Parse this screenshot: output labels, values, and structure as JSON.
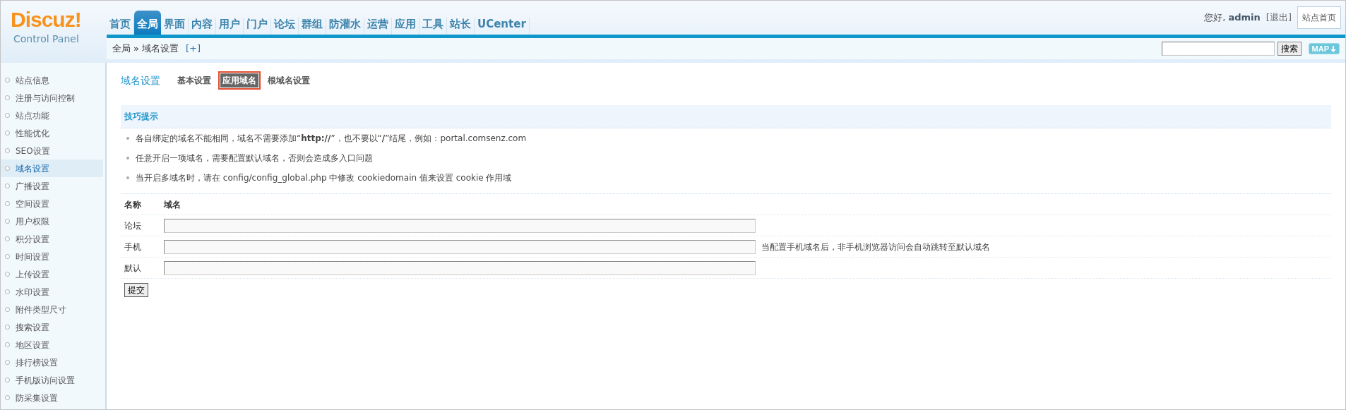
{
  "logo": {
    "title": "Discuz!",
    "subtitle": "Control Panel"
  },
  "nav": [
    {
      "label": "首页",
      "selected": false
    },
    {
      "label": "全局",
      "selected": true
    },
    {
      "label": "界面",
      "selected": false
    },
    {
      "label": "内容",
      "selected": false
    },
    {
      "label": "用户",
      "selected": false
    },
    {
      "label": "门户",
      "selected": false
    },
    {
      "label": "论坛",
      "selected": false
    },
    {
      "label": "群组",
      "selected": false
    },
    {
      "label": "防灌水",
      "selected": false
    },
    {
      "label": "运营",
      "selected": false
    },
    {
      "label": "应用",
      "selected": false
    },
    {
      "label": "工具",
      "selected": false
    },
    {
      "label": "站长",
      "selected": false
    },
    {
      "label": "UCenter",
      "selected": false
    }
  ],
  "user": {
    "greeting": "您好,",
    "name": "admin",
    "logout": "[退出]",
    "home": "站点首页"
  },
  "breadcrumb": {
    "root": "全局",
    "sep": "»",
    "current": "域名设置",
    "add": "[+]"
  },
  "search": {
    "button": "搜索",
    "map": "MAP"
  },
  "sidebar": {
    "items": [
      {
        "label": "站点信息",
        "selected": false
      },
      {
        "label": "注册与访问控制",
        "selected": false
      },
      {
        "label": "站点功能",
        "selected": false
      },
      {
        "label": "性能优化",
        "selected": false
      },
      {
        "label": "SEO设置",
        "selected": false
      },
      {
        "label": "域名设置",
        "selected": true
      },
      {
        "label": "广播设置",
        "selected": false
      },
      {
        "label": "空间设置",
        "selected": false
      },
      {
        "label": "用户权限",
        "selected": false
      },
      {
        "label": "积分设置",
        "selected": false
      },
      {
        "label": "时间设置",
        "selected": false
      },
      {
        "label": "上传设置",
        "selected": false
      },
      {
        "label": "水印设置",
        "selected": false
      },
      {
        "label": "附件类型尺寸",
        "selected": false
      },
      {
        "label": "搜索设置",
        "selected": false
      },
      {
        "label": "地区设置",
        "selected": false
      },
      {
        "label": "排行榜设置",
        "selected": false
      },
      {
        "label": "手机版访问设置",
        "selected": false
      },
      {
        "label": "防采集设置",
        "selected": false
      }
    ]
  },
  "page": {
    "title": "域名设置",
    "tabs": [
      {
        "label": "基本设置",
        "selected": false,
        "highlighted": false
      },
      {
        "label": "应用域名",
        "selected": true,
        "highlighted": true
      },
      {
        "label": "根域名设置",
        "selected": false,
        "highlighted": false
      }
    ]
  },
  "tips": {
    "title": "技巧提示",
    "items": [
      "各自绑定的域名不能相同，域名不需要添加“**http://**”，也不要以“**/**”结尾，例如：portal.comsenz.com",
      "任意开启一项域名，需要配置默认域名，否则会造成多入口问题",
      "当开启多域名时，请在 config/config_global.php 中修改 cookiedomain 值来设置 cookie 作用域"
    ]
  },
  "table": {
    "columns": [
      "名称",
      "域名"
    ],
    "rows": [
      {
        "name": "论坛"
      },
      {
        "name": "手机",
        "note": "当配置手机域名后，非手机浏览器访问会自动跳转至默认域名"
      },
      {
        "name": "默认"
      }
    ]
  },
  "submit": "提交"
}
